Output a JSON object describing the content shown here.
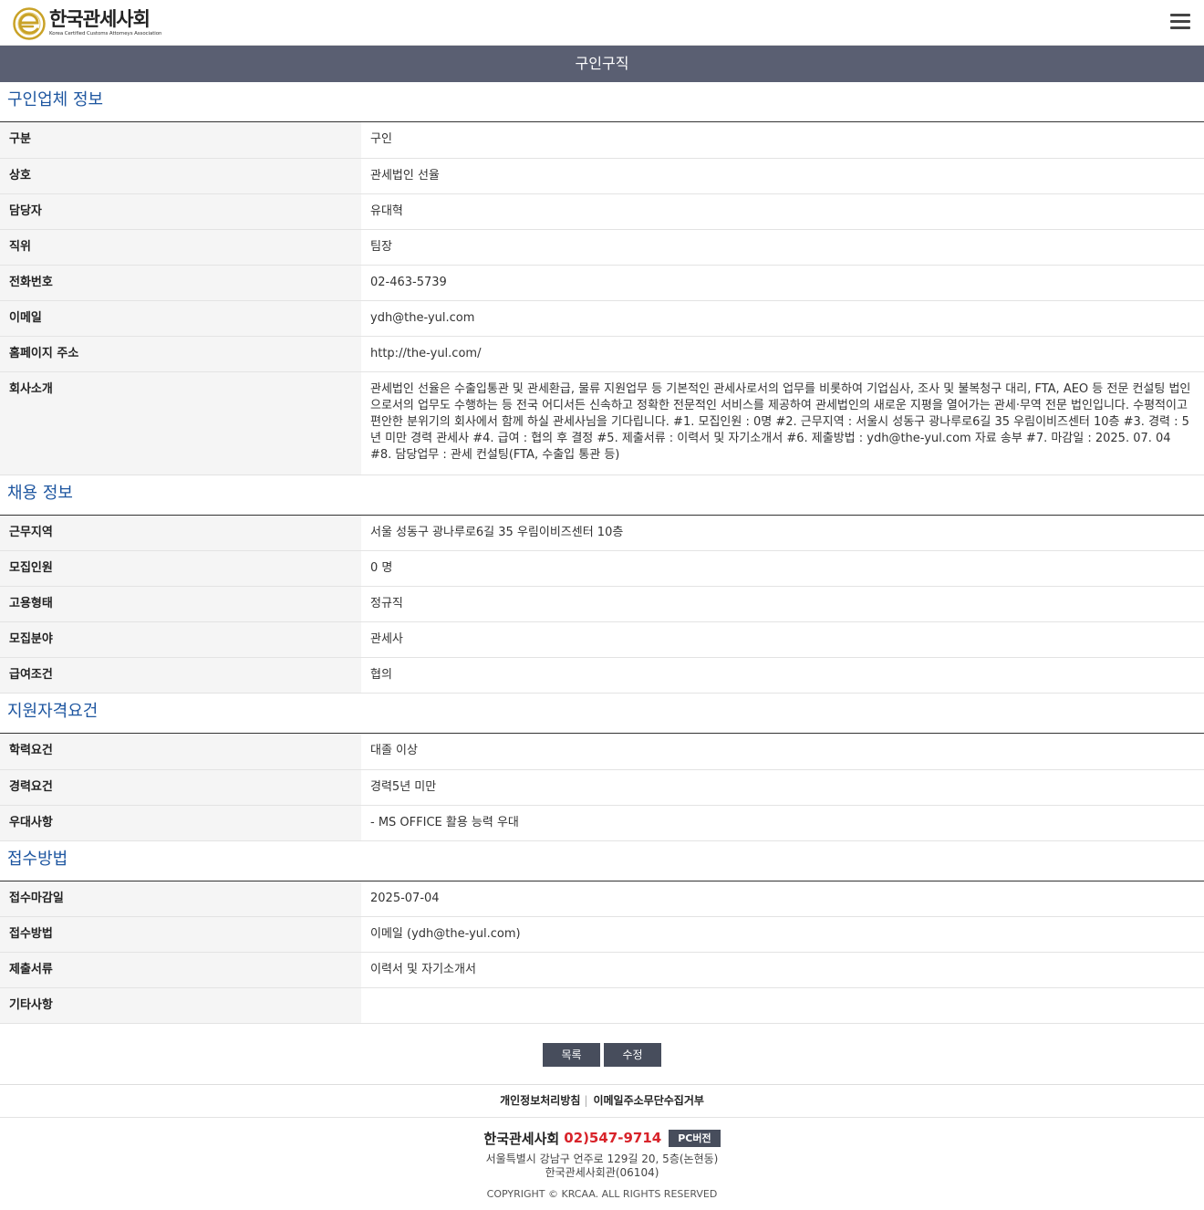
{
  "header": {
    "logo_ko": "한국관세사회",
    "logo_en": "Korea Certified Customs Attorneys Association"
  },
  "page_title": "구인구직",
  "company_section": {
    "heading": "구인업체 정보",
    "rows": [
      {
        "label": "구분",
        "value": "구인"
      },
      {
        "label": "상호",
        "value": "관세법인 선율"
      },
      {
        "label": "담당자",
        "value": "유대혁"
      },
      {
        "label": "직위",
        "value": "팀장"
      },
      {
        "label": "전화번호",
        "value": "02-463-5739"
      },
      {
        "label": "이메일",
        "value": "ydh@the-yul.com"
      },
      {
        "label": "홈페이지 주소",
        "value": "http://the-yul.com/"
      },
      {
        "label": "회사소개",
        "value": "관세법인 선율은 수출입통관 및 관세환급, 물류 지원업무 등 기본적인 관세사로서의 업무를 비롯하여 기업심사, 조사 및 불복청구 대리, FTA, AEO 등 전문 컨설팅 법인으로서의 업무도 수행하는 등 전국 어디서든 신속하고 정확한 전문적인 서비스를 제공하여 관세법인의 새로운 지평을 열어가는 관세·무역 전문 법인입니다. 수평적이고 편안한 분위기의 회사에서 함께 하실 관세사님을 기다립니다. #1. 모집인원 : 0명 #2. 근무지역 : 서울시 성동구 광나루로6길 35 우림이비즈센터 10층 #3. 경력 : 5년 미만 경력 관세사 #4. 급여 : 협의 후 결정 #5. 제출서류 : 이력서 및 자기소개서 #6. 제출방법 : ydh@the-yul.com 자료 송부 #7. 마감일 : 2025. 07. 04 #8. 담당업무 : 관세 컨설팅(FTA, 수출입 통관 등)"
      }
    ]
  },
  "job_section": {
    "heading": "채용 정보",
    "rows": [
      {
        "label": "근무지역",
        "value": "서울 성동구 광나루로6길 35 우림이비즈센터 10층"
      },
      {
        "label": "모집인원",
        "value": "0 명"
      },
      {
        "label": "고용형태",
        "value": "정규직"
      },
      {
        "label": "모집분야",
        "value": "관세사"
      },
      {
        "label": "급여조건",
        "value": "협의"
      }
    ]
  },
  "qualification_section": {
    "heading": "지원자격요건",
    "rows": [
      {
        "label": "학력요건",
        "value": "대졸 이상"
      },
      {
        "label": "경력요건",
        "value": "경력5년 미만"
      },
      {
        "label": "우대사항",
        "value": "- MS OFFICE 활용 능력 우대"
      }
    ]
  },
  "apply_section": {
    "heading": "접수방법",
    "rows": [
      {
        "label": "접수마감일",
        "value": "2025-07-04"
      },
      {
        "label": "접수방법",
        "value": "이메일 (ydh@the-yul.com)"
      },
      {
        "label": "제출서류",
        "value": "이력서 및 자기소개서"
      },
      {
        "label": "기타사항",
        "value": ""
      }
    ]
  },
  "buttons": {
    "list": "목록",
    "edit": "수정"
  },
  "footer": {
    "privacy_link": "개인정보처리방침",
    "email_link": "이메일주소무단수집거부",
    "org_name": "한국관세사회",
    "tel": "02)547-9714",
    "pc_button": "PC버전",
    "address1": "서울특별시 강남구 언주로 129길 20, 5층(논현동)",
    "address2": "한국관세사회관(06104)",
    "copyright": "COPYRIGHT © KRCAA. ALL RIGHTS RESERVED"
  },
  "colors": {
    "title_bar": "#5a5f72",
    "section_heading": "#1e56a0",
    "button": "#474d5c",
    "tel": "#d8232a",
    "logo_gold": "#c9a227"
  }
}
